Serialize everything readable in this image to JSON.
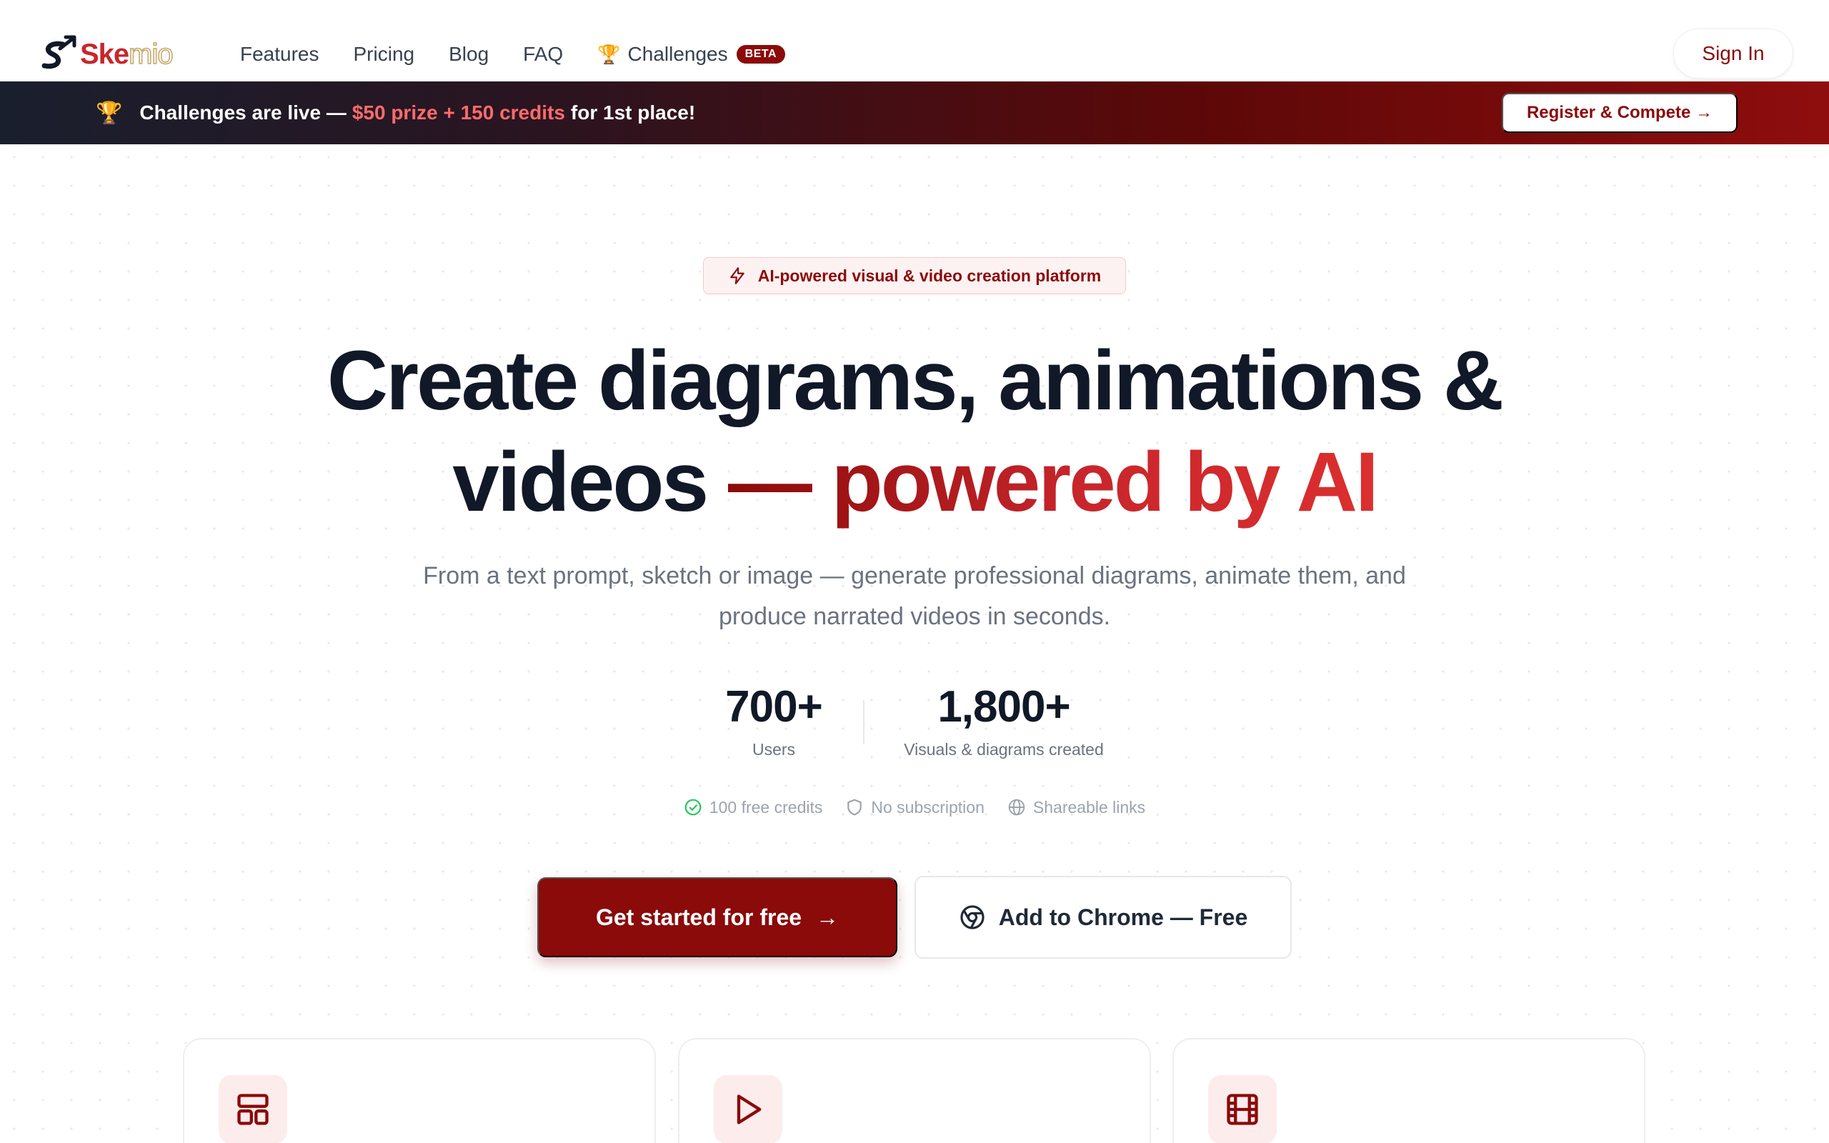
{
  "brand": {
    "name_part1": "Ske",
    "name_part2": "mio"
  },
  "nav": {
    "links": [
      "Features",
      "Pricing",
      "Blog",
      "FAQ"
    ],
    "challenges_label": "Challenges",
    "beta_badge": "BETA",
    "signin_label": "Sign In"
  },
  "banner": {
    "prefix": "Challenges are live —",
    "highlight": "$50 prize + 150 credits",
    "suffix": "for 1st place!",
    "button_label": "Register & Compete →"
  },
  "hero": {
    "pill_label": "AI-powered visual & video creation platform",
    "headline_line1": "Create diagrams, animations &",
    "headline_line2_prefix": "videos",
    "headline_line2_accent": "— powered by AI",
    "subtitle": "From a text prompt, sketch or image — generate professional diagrams, animate them, and produce narrated videos in seconds."
  },
  "stats": [
    {
      "value": "700+",
      "label": "Users"
    },
    {
      "value": "1,800+",
      "label": "Visuals & diagrams created"
    }
  ],
  "features": [
    {
      "icon": "check-circle-icon",
      "label": "100 free credits"
    },
    {
      "icon": "shield-icon",
      "label": "No subscription"
    },
    {
      "icon": "globe-icon",
      "label": "Shareable links"
    }
  ],
  "cta": {
    "primary_label": "Get started for free",
    "secondary_label": "Add to Chrome — Free"
  },
  "cards": [
    {
      "icon": "layout-icon"
    },
    {
      "icon": "play-icon"
    },
    {
      "icon": "film-icon"
    }
  ],
  "colors": {
    "brand_red": "#8b0a0a",
    "accent_red": "#c8262c",
    "banner_highlight": "#ff6b6b",
    "text_dark": "#111827",
    "text_muted": "#6b7280"
  }
}
